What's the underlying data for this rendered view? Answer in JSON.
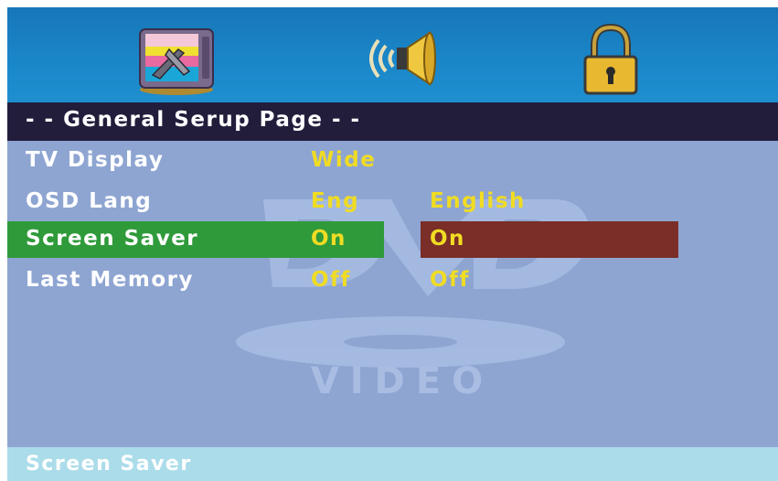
{
  "top_icons": [
    {
      "name": "general-setup-tv-icon"
    },
    {
      "name": "audio-speaker-icon"
    },
    {
      "name": "lock-icon"
    }
  ],
  "title": "- - General Serup Page - -",
  "rows": [
    {
      "label": "TV Display",
      "value": "Wide",
      "option": ""
    },
    {
      "label": "OSD Lang",
      "value": "Eng",
      "option": "English"
    },
    {
      "label": "Screen Saver",
      "value": "On",
      "option": "On"
    },
    {
      "label": "Last Memory",
      "value": "Off",
      "option": "Off"
    }
  ],
  "watermark": {
    "text": "VIDEO"
  },
  "status": "Screen Saver",
  "colors": {
    "icon_bar": "#1a86c8",
    "title_bar": "#231d3c",
    "content_bg": "#8ea5d2",
    "label_text": "#ffffff",
    "value_text": "#f0dc23",
    "highlight_green": "#2f9a3a",
    "highlight_brown": "#7a2e27",
    "status_bar": "#abdcea"
  }
}
